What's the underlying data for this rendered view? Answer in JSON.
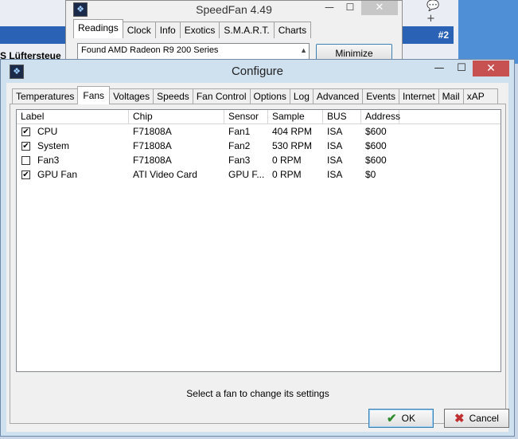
{
  "background": {
    "left_text": "S Lüftersteue",
    "right_badge": "#2"
  },
  "speedfan": {
    "title": "SpeedFan 4.49",
    "tabs": [
      "Readings",
      "Clock",
      "Info",
      "Exotics",
      "S.M.A.R.T.",
      "Charts"
    ],
    "readings_line1": "Found AMD Radeon R9 200 Series",
    "minimize_label": "Minimize"
  },
  "configure": {
    "title": "Configure",
    "tabs": [
      "Temperatures",
      "Fans",
      "Voltages",
      "Speeds",
      "Fan Control",
      "Options",
      "Log",
      "Advanced",
      "Events",
      "Internet",
      "Mail",
      "xAP"
    ],
    "active_tab": "Fans",
    "columns": [
      "Label",
      "Chip",
      "Sensor",
      "Sample",
      "BUS",
      "Address"
    ],
    "rows": [
      {
        "checked": true,
        "label": "CPU",
        "chip": "F71808A",
        "sensor": "Fan1",
        "sample": "404 RPM",
        "bus": "ISA",
        "address": "$600"
      },
      {
        "checked": true,
        "label": "System",
        "chip": "F71808A",
        "sensor": "Fan2",
        "sample": "530 RPM",
        "bus": "ISA",
        "address": "$600"
      },
      {
        "checked": false,
        "label": "Fan3",
        "chip": "F71808A",
        "sensor": "Fan3",
        "sample": "0 RPM",
        "bus": "ISA",
        "address": "$600"
      },
      {
        "checked": true,
        "label": "GPU Fan",
        "chip": "ATI Video Card",
        "sensor": "GPU F...",
        "sample": "0 RPM",
        "bus": "ISA",
        "address": "$0"
      }
    ],
    "status_text": "Select a fan to change its settings",
    "ok_label": "OK",
    "cancel_label": "Cancel"
  },
  "colors": {
    "close_button": "#c75050",
    "frame": "#cfe0ef",
    "ok_check": "#2e8b2e",
    "cancel_x": "#c03030"
  }
}
